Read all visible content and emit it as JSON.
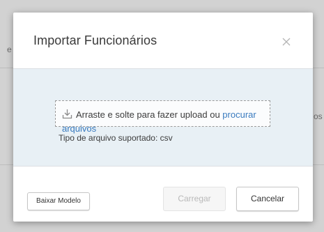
{
  "modal": {
    "title": "Importar Funcionários"
  },
  "dropzone": {
    "text": "Arraste e solte para fazer upload ou ",
    "browse_link_part1": "procurar",
    "browse_link_part2": "arquivos",
    "supported_types": "Tipo de arquivo suportado: csv"
  },
  "footer": {
    "template_button": "Baixar Modelo",
    "load_button": "Carregar",
    "cancel_button": "Cancelar"
  },
  "background": {
    "left_fragment": "e",
    "right_fragment": "os"
  },
  "colors": {
    "link": "#3a7bbf",
    "dropzone_area": "#e8f0f5",
    "disabled_text": "#b9b9b9"
  },
  "icons": {
    "close": "close-icon",
    "upload": "upload-icon"
  }
}
